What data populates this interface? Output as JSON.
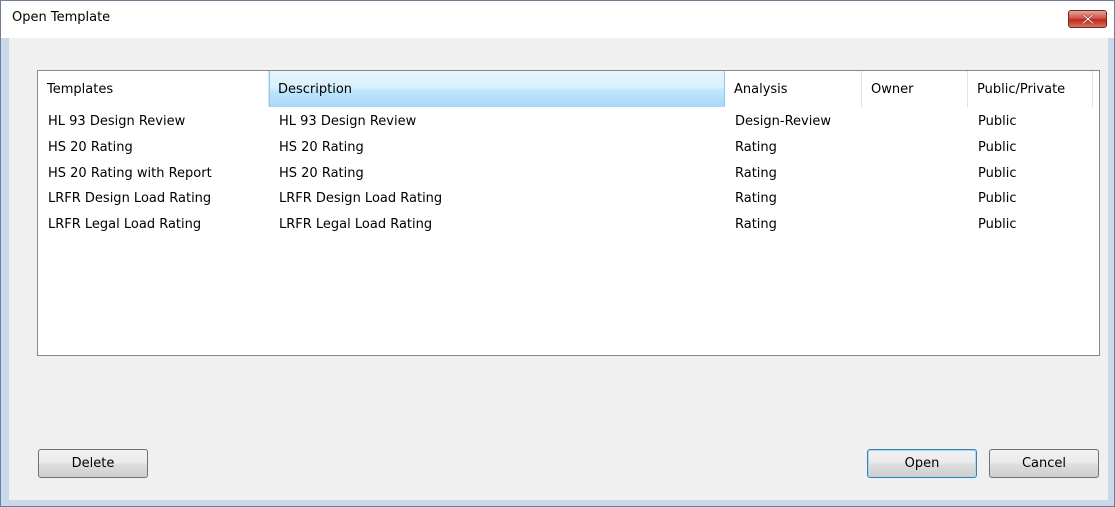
{
  "window": {
    "title": "Open Template",
    "close_icon": "close-icon"
  },
  "list": {
    "columns": [
      "Templates",
      "Description",
      "Analysis",
      "Owner",
      "Public/Private"
    ],
    "rows": [
      {
        "template": "HL 93 Design Review",
        "description": "HL 93 Design Review",
        "analysis": "Design-Review",
        "owner": "",
        "visibility": "Public"
      },
      {
        "template": "HS 20 Rating",
        "description": "HS 20 Rating",
        "analysis": "Rating",
        "owner": "",
        "visibility": "Public"
      },
      {
        "template": "HS 20 Rating with Report",
        "description": "HS 20 Rating",
        "analysis": "Rating",
        "owner": "",
        "visibility": "Public"
      },
      {
        "template": "LRFR Design Load Rating",
        "description": "LRFR Design Load Rating",
        "analysis": "Rating",
        "owner": "",
        "visibility": "Public"
      },
      {
        "template": "LRFR Legal Load Rating",
        "description": "LRFR Legal Load Rating",
        "analysis": "Rating",
        "owner": "",
        "visibility": "Public"
      }
    ]
  },
  "buttons": {
    "delete": "Delete",
    "open": "Open",
    "cancel": "Cancel"
  },
  "colors": {
    "header_hover": "#bee6fd",
    "close_button": "#c1281b",
    "dialog_background": "#f0f0f0"
  }
}
